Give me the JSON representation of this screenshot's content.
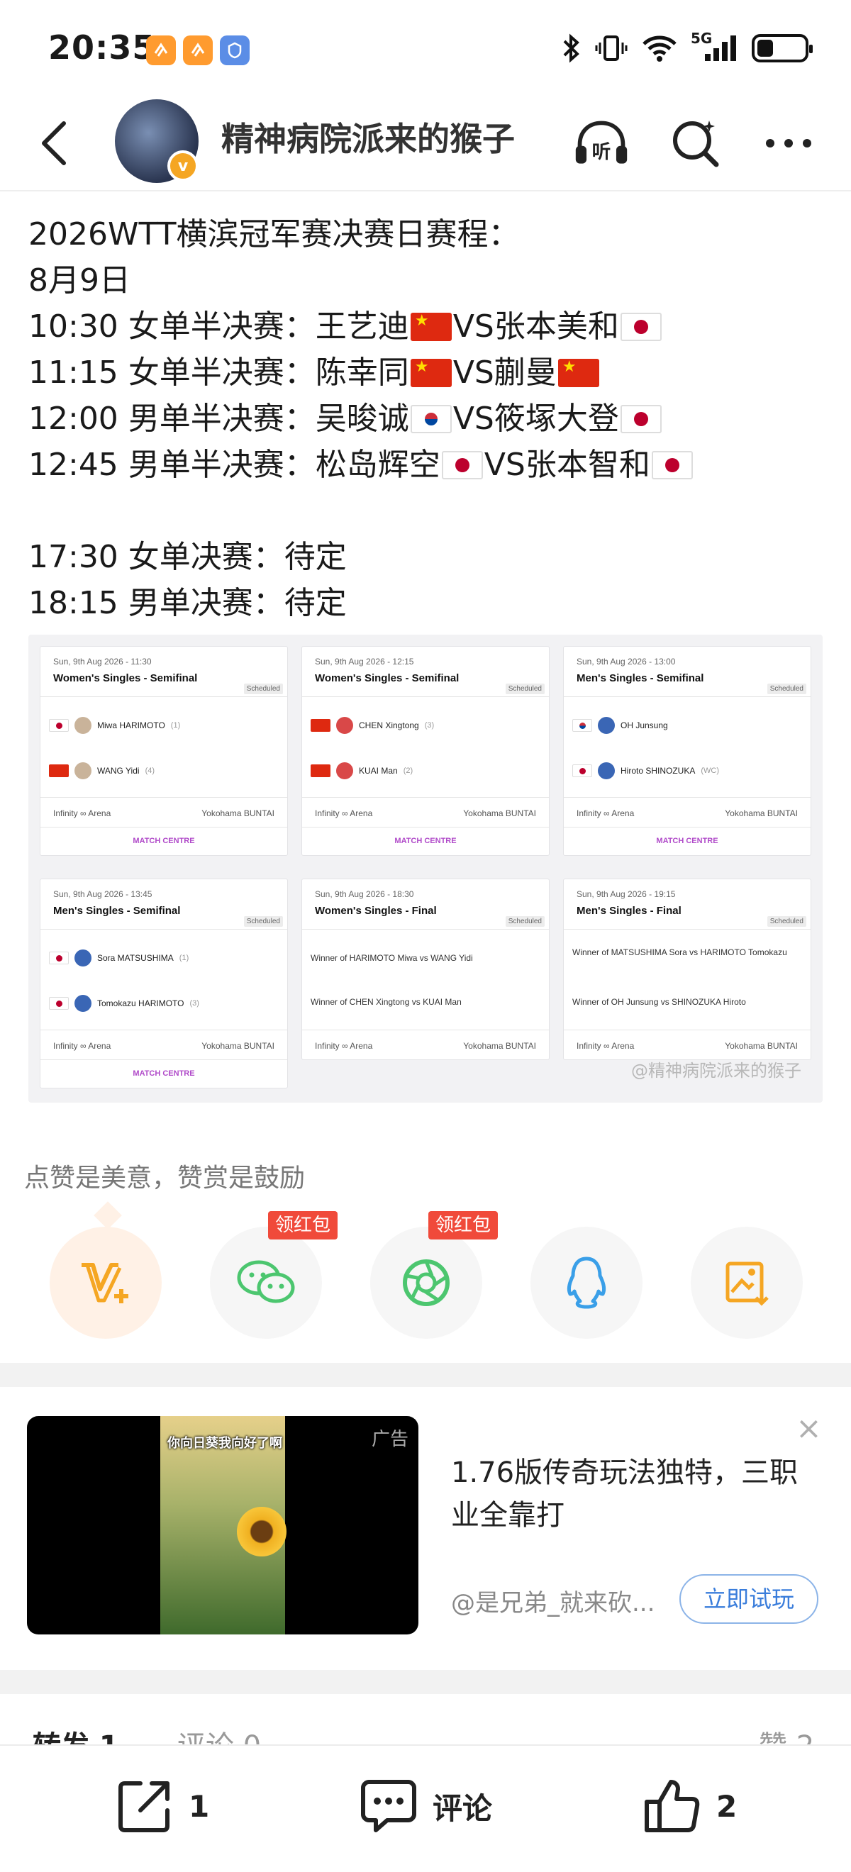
{
  "status_bar": {
    "time": "20:35",
    "network": "5G"
  },
  "header": {
    "username": "精神病院派来的猴子"
  },
  "post": {
    "lines": [
      {
        "text": "2026WTT横滨冠军赛决赛日赛程："
      },
      {
        "text": "8月9日"
      },
      {
        "time": "10:30",
        "event": "女单半决赛：",
        "p1": "王艺迪",
        "f1": "cn",
        "vs": "VS",
        "p2": "张本美和",
        "f2": "jp"
      },
      {
        "time": "11:15",
        "event": "女单半决赛：",
        "p1": "陈幸同",
        "f1": "cn",
        "vs": "VS",
        "p2": "蒯曼",
        "f2": "cn"
      },
      {
        "time": "12:00",
        "event": "男单半决赛：",
        "p1": "吴晙诚",
        "f1": "kr",
        "vs": "VS",
        "p2": "筱塚大登",
        "f2": "jp"
      },
      {
        "time": "12:45",
        "event": "男单半决赛：",
        "p1": "松岛辉空",
        "f1": "jp",
        "vs": "VS",
        "p2": "张本智和",
        "f2": "jp"
      },
      {
        "text": ""
      },
      {
        "text": "17:30 女单决赛：待定"
      },
      {
        "text": "18:15 男单决赛：待定"
      }
    ]
  },
  "match_image": {
    "cards": [
      {
        "date": "Sun, 9th Aug 2026 - 11:30",
        "title": "Women's Singles - Semifinal",
        "status": "Scheduled",
        "players": [
          {
            "name": "Miwa HARIMOTO",
            "seed": "(1)",
            "flag": "jp"
          },
          {
            "name": "WANG Yidi",
            "seed": "(4)",
            "flag": "cn"
          }
        ],
        "venue": "Infinity ∞ Arena",
        "venue_r": "Yokohama BUNTAI",
        "centre": "MATCH CENTRE"
      },
      {
        "date": "Sun, 9th Aug 2026 - 12:15",
        "title": "Women's Singles - Semifinal",
        "status": "Scheduled",
        "players": [
          {
            "name": "CHEN Xingtong",
            "seed": "(3)",
            "flag": "cn"
          },
          {
            "name": "KUAI Man",
            "seed": "(2)",
            "flag": "cn"
          }
        ],
        "venue": "Infinity ∞ Arena",
        "venue_r": "Yokohama BUNTAI",
        "centre": "MATCH CENTRE"
      },
      {
        "date": "Sun, 9th Aug 2026 - 13:00",
        "title": "Men's Singles - Semifinal",
        "status": "Scheduled",
        "players": [
          {
            "name": "OH Junsung",
            "seed": "",
            "flag": "kr"
          },
          {
            "name": "Hiroto SHINOZUKA",
            "seed": "(WC)",
            "flag": "jp"
          }
        ],
        "venue": "Infinity ∞ Arena",
        "venue_r": "Yokohama BUNTAI",
        "centre": "MATCH CENTRE"
      },
      {
        "date": "Sun, 9th Aug 2026 - 13:45",
        "title": "Men's Singles - Semifinal",
        "status": "Scheduled",
        "players": [
          {
            "name": "Sora MATSUSHIMA",
            "seed": "(1)",
            "flag": "jp"
          },
          {
            "name": "Tomokazu HARIMOTO",
            "seed": "(3)",
            "flag": "jp"
          }
        ],
        "venue": "Infinity ∞ Arena",
        "venue_r": "Yokohama BUNTAI",
        "centre": "MATCH CENTRE"
      },
      {
        "date": "Sun, 9th Aug 2026 - 18:30",
        "title": "Women's Singles - Final",
        "status": "Scheduled",
        "winners": [
          "Winner of HARIMOTO Miwa vs WANG Yidi",
          "Winner of CHEN Xingtong vs KUAI Man"
        ],
        "venue": "Infinity ∞ Arena",
        "venue_r": "Yokohama BUNTAI"
      },
      {
        "date": "Sun, 9th Aug 2026 - 19:15",
        "title": "Men's Singles - Final",
        "status": "Scheduled",
        "winners": [
          "Winner of MATSUSHIMA Sora vs HARIMOTO Tomokazu",
          "Winner of OH Junsung vs SHINOZUKA Hiroto"
        ],
        "venue": "Infinity ∞ Arena",
        "venue_r": "Yokohama BUNTAI"
      }
    ],
    "watermark": "@精神病院派来的猴子"
  },
  "reward": {
    "hint": "点赞是美意，赞赏是鼓励",
    "tag_label": "领红包"
  },
  "ad": {
    "label": "广告",
    "video_caption": "你向日葵我向好了啊",
    "title": "1.76版传奇玩法独特，三职业全靠打",
    "source": "@是兄弟_就来砍...",
    "cta": "立即试玩",
    "close": "×"
  },
  "tabs": {
    "repost": "转发 1",
    "comment": "评论 0",
    "like": "赞 2"
  },
  "bottom_bar": {
    "share_count": "1",
    "comment_label": "评论",
    "like_count": "2"
  },
  "colors": {
    "accent_orange": "#f5a623",
    "red_tag": "#f04a3a",
    "cta_blue": "#3a7ddb",
    "wechat_green": "#4cc66f"
  }
}
